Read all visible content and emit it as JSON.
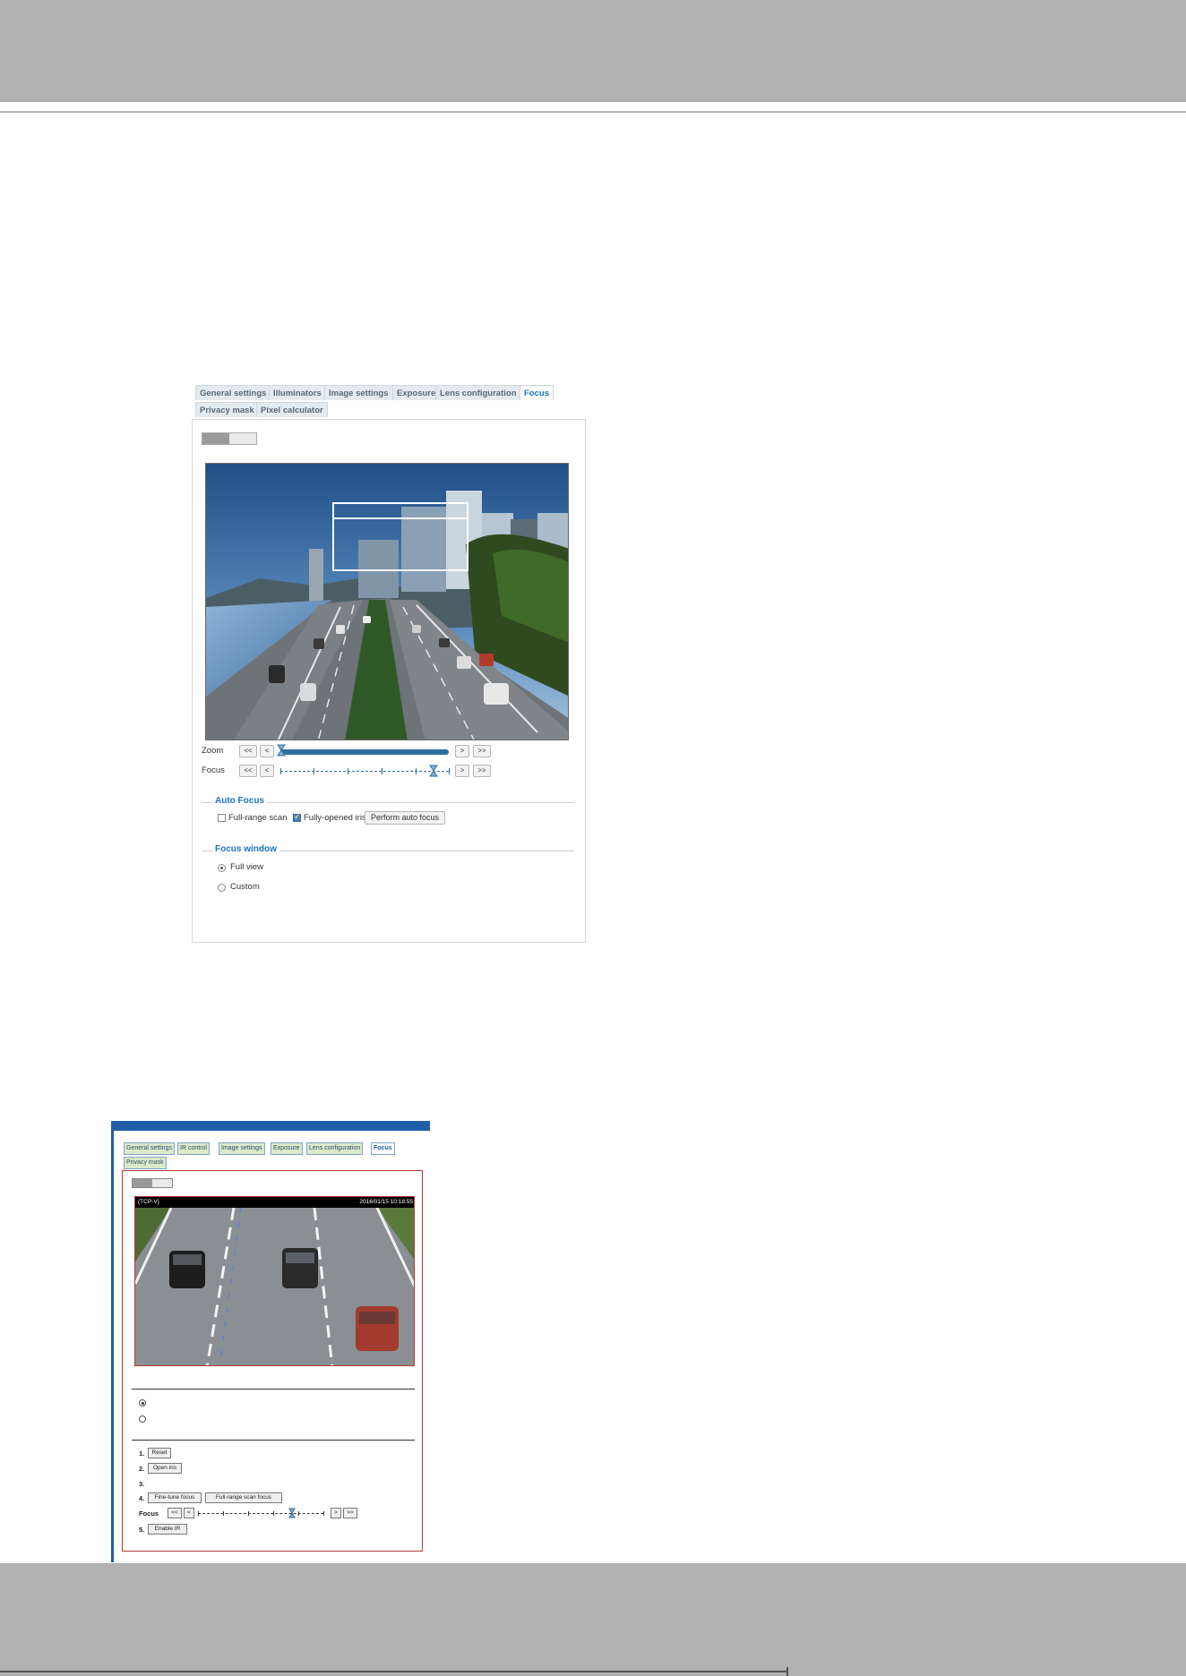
{
  "fig1": {
    "tabs": [
      "General settings",
      "Illuminators",
      "Image settings",
      "Exposure",
      "Lens configuration",
      "Focus",
      "Privacy mask",
      "Pixel calculator"
    ],
    "active_tab": "Focus",
    "stream_toggle": [
      "",
      ""
    ],
    "zoom": {
      "label": "Zoom",
      "buttons": [
        "<<",
        "<",
        ">",
        ">>"
      ],
      "slider_fraction": 0
    },
    "focus": {
      "label": "Focus",
      "buttons": [
        "<<",
        "<",
        ">",
        ">>"
      ],
      "slider_fraction": 0.9
    },
    "auto_focus": {
      "title": "Auto Focus",
      "full_range_scan_label": "Full-range scan",
      "full_range_scan_checked": false,
      "fully_opened_iris_label": "Fully-opened iris",
      "fully_opened_iris_checked": true,
      "perform_button": "Perform auto focus"
    },
    "focus_window": {
      "title": "Focus window",
      "options": [
        "Full view",
        "Custom"
      ],
      "selected": "Full view"
    }
  },
  "fig2": {
    "title": "",
    "tabs": [
      "General settings",
      "IR control",
      "Image settings",
      "Exposure",
      "Lens configuration",
      "Focus",
      "Privacy mask"
    ],
    "active_tab": "Focus",
    "stream_toggle": [
      "",
      ""
    ],
    "video_overlay_left": "(TCP-V)",
    "video_overlay_right": "2016/01/15 10:18:55",
    "focus_window": {
      "title": "",
      "options": [
        "",
        ""
      ]
    },
    "manual_focus": {
      "title": "",
      "step1_num": "1.",
      "reset_button": "Reset",
      "step1_text": "",
      "step2_num": "2.",
      "open_iris_button": "Open iris",
      "step3_num": "3.",
      "step3_text": "",
      "step4_num": "4.",
      "fine_tune_button": "Fine-tune focus",
      "full_range_button": "Full-range scan focus",
      "focus_label": "Focus",
      "focus_buttons": [
        "<<",
        "<",
        ">",
        ">>"
      ],
      "step5_num": "5.",
      "enable_ir_button": "Enable IR"
    }
  }
}
